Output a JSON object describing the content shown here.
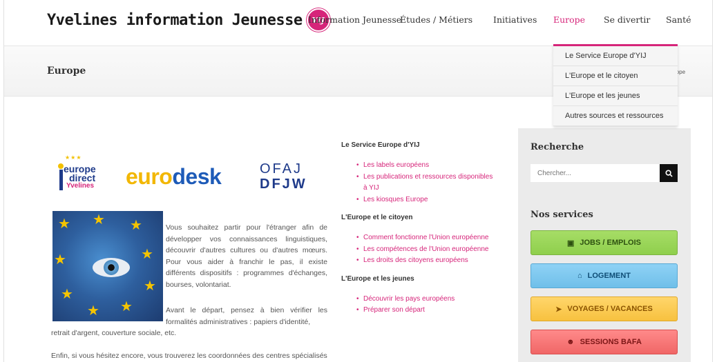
{
  "header": {
    "logo_text": "Yvelines information Jeunesse",
    "logo_badge": "YIJ",
    "nav": [
      {
        "label": "Information Jeunesse",
        "active": false
      },
      {
        "label": "Études / Métiers",
        "active": false
      },
      {
        "label": "Initiatives",
        "active": false
      },
      {
        "label": "Europe",
        "active": true
      },
      {
        "label": "Se divertir",
        "active": false
      },
      {
        "label": "Santé",
        "active": false
      }
    ],
    "dropdown": [
      "Le Service Europe d'YIJ",
      "L'Europe et le citoyen",
      "L'Europe et les jeunes",
      "Autres sources et ressources"
    ]
  },
  "titlebar": {
    "title": "Europe",
    "breadcrumb_tail": "rope"
  },
  "logos": {
    "europe_direct": [
      "europe",
      "direct",
      "Yvelines"
    ],
    "eurodesk_a": "euro",
    "eurodesk_b": "desk",
    "ofaj_row1": "OFAJ",
    "ofaj_row2": "DFJW"
  },
  "intro": {
    "p1": "Vous souhaitez partir pour l'étranger afin de développer vos connaissances linguistiques, découvrir d'autres cultures ou d'autres mœurs. Pour vous aider à franchir le pas, il existe différents dispositifs : programmes d'échanges, bourses, volontariat.",
    "p2a": "Avant le départ, pensez à bien vérifier les formalités administratives : papiers d'identité,",
    "p2b": "retrait d'argent, couverture sociale, etc.",
    "p3": "Enfin, si vous hésitez encore, vous trouverez les coordonnées des centres spécialisés"
  },
  "middle": {
    "sections": [
      {
        "heading": "Le Service Europe d'YIJ",
        "links": [
          "Les labels européens",
          "Les publications et ressources disponibles à YIJ",
          "Les kiosques Europe"
        ]
      },
      {
        "heading": "L'Europe et le citoyen",
        "links": [
          "Comment fonctionne l'Union européenne",
          "Les compétences de l'Union européenne",
          "Les droits des citoyens européens"
        ]
      },
      {
        "heading": "L'Europe et les jeunes",
        "links": [
          "Découvrir les pays européens",
          "Préparer son départ"
        ]
      }
    ]
  },
  "sidebar": {
    "search_title": "Recherche",
    "search_placeholder": "Chercher...",
    "services_title": "Nos services",
    "buttons": [
      {
        "label": "JOBS / EMPLOIS",
        "icon": "briefcase-icon"
      },
      {
        "label": "LOGEMENT",
        "icon": "home-icon"
      },
      {
        "label": "VOYAGES / VACANCES",
        "icon": "plane-icon"
      },
      {
        "label": "SESSIONS BAFA",
        "icon": "users-icon"
      }
    ]
  },
  "colors": {
    "accent": "#d6257a"
  }
}
